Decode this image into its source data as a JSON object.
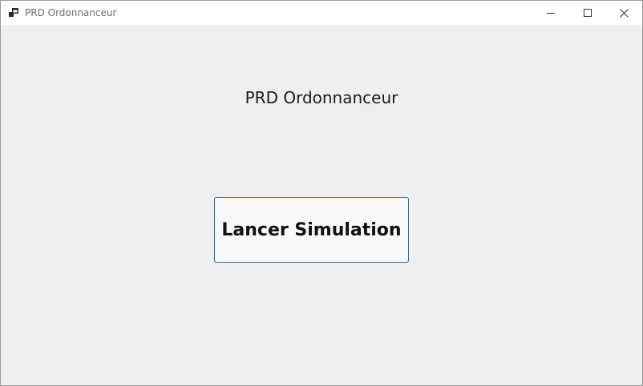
{
  "window": {
    "title": "PRD Ordonnanceur",
    "app_icon": "app-window-icon",
    "controls": {
      "minimize_icon": "minimize-icon",
      "maximize_icon": "maximize-icon",
      "close_icon": "close-icon"
    }
  },
  "main": {
    "heading": "PRD Ordonnanceur",
    "launch_button_label": "Lancer Simulation"
  },
  "colors": {
    "button_border": "#1a6fb4",
    "background": "#efefef"
  }
}
